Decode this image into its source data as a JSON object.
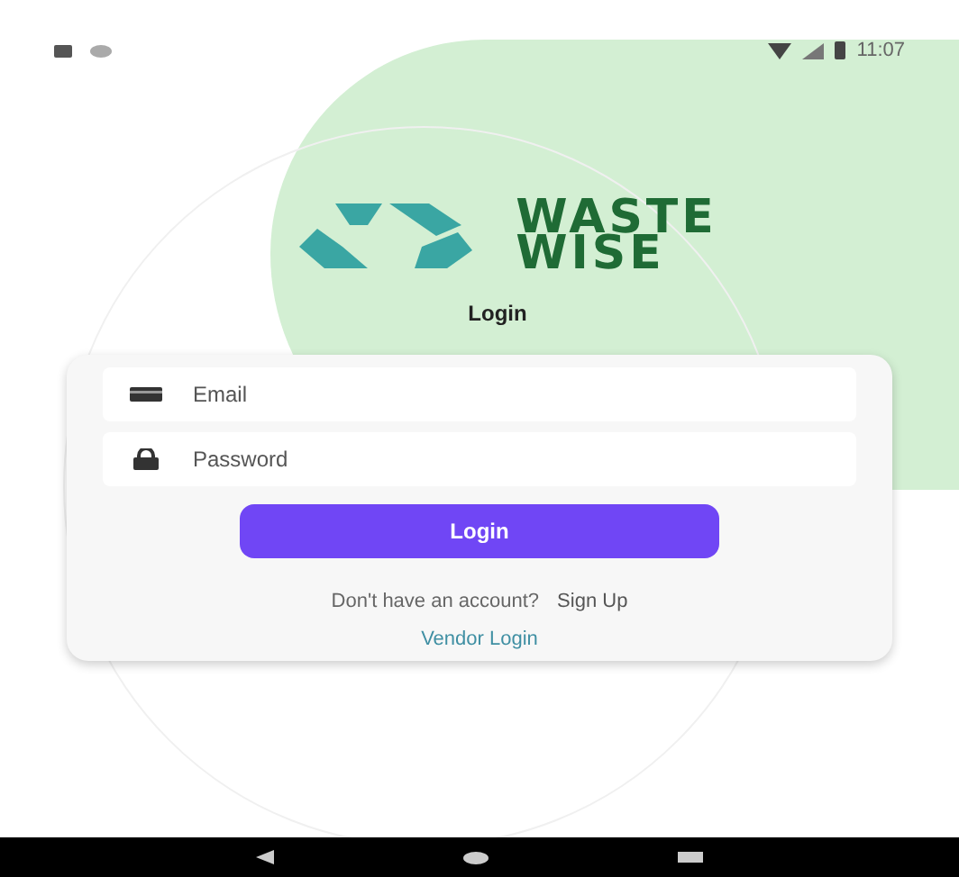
{
  "status_bar": {
    "time": "11:07"
  },
  "logo": {
    "lines": [
      "WASTE",
      "WISE"
    ]
  },
  "title": "Login",
  "fields": [
    {
      "kind": "email",
      "placeholder": "Email"
    },
    {
      "kind": "password",
      "placeholder": "Password"
    }
  ],
  "login_button": "Login",
  "signup": {
    "prompt": "Don't have an account?",
    "link": "Sign Up"
  },
  "vendor_link": "Vendor Login"
}
